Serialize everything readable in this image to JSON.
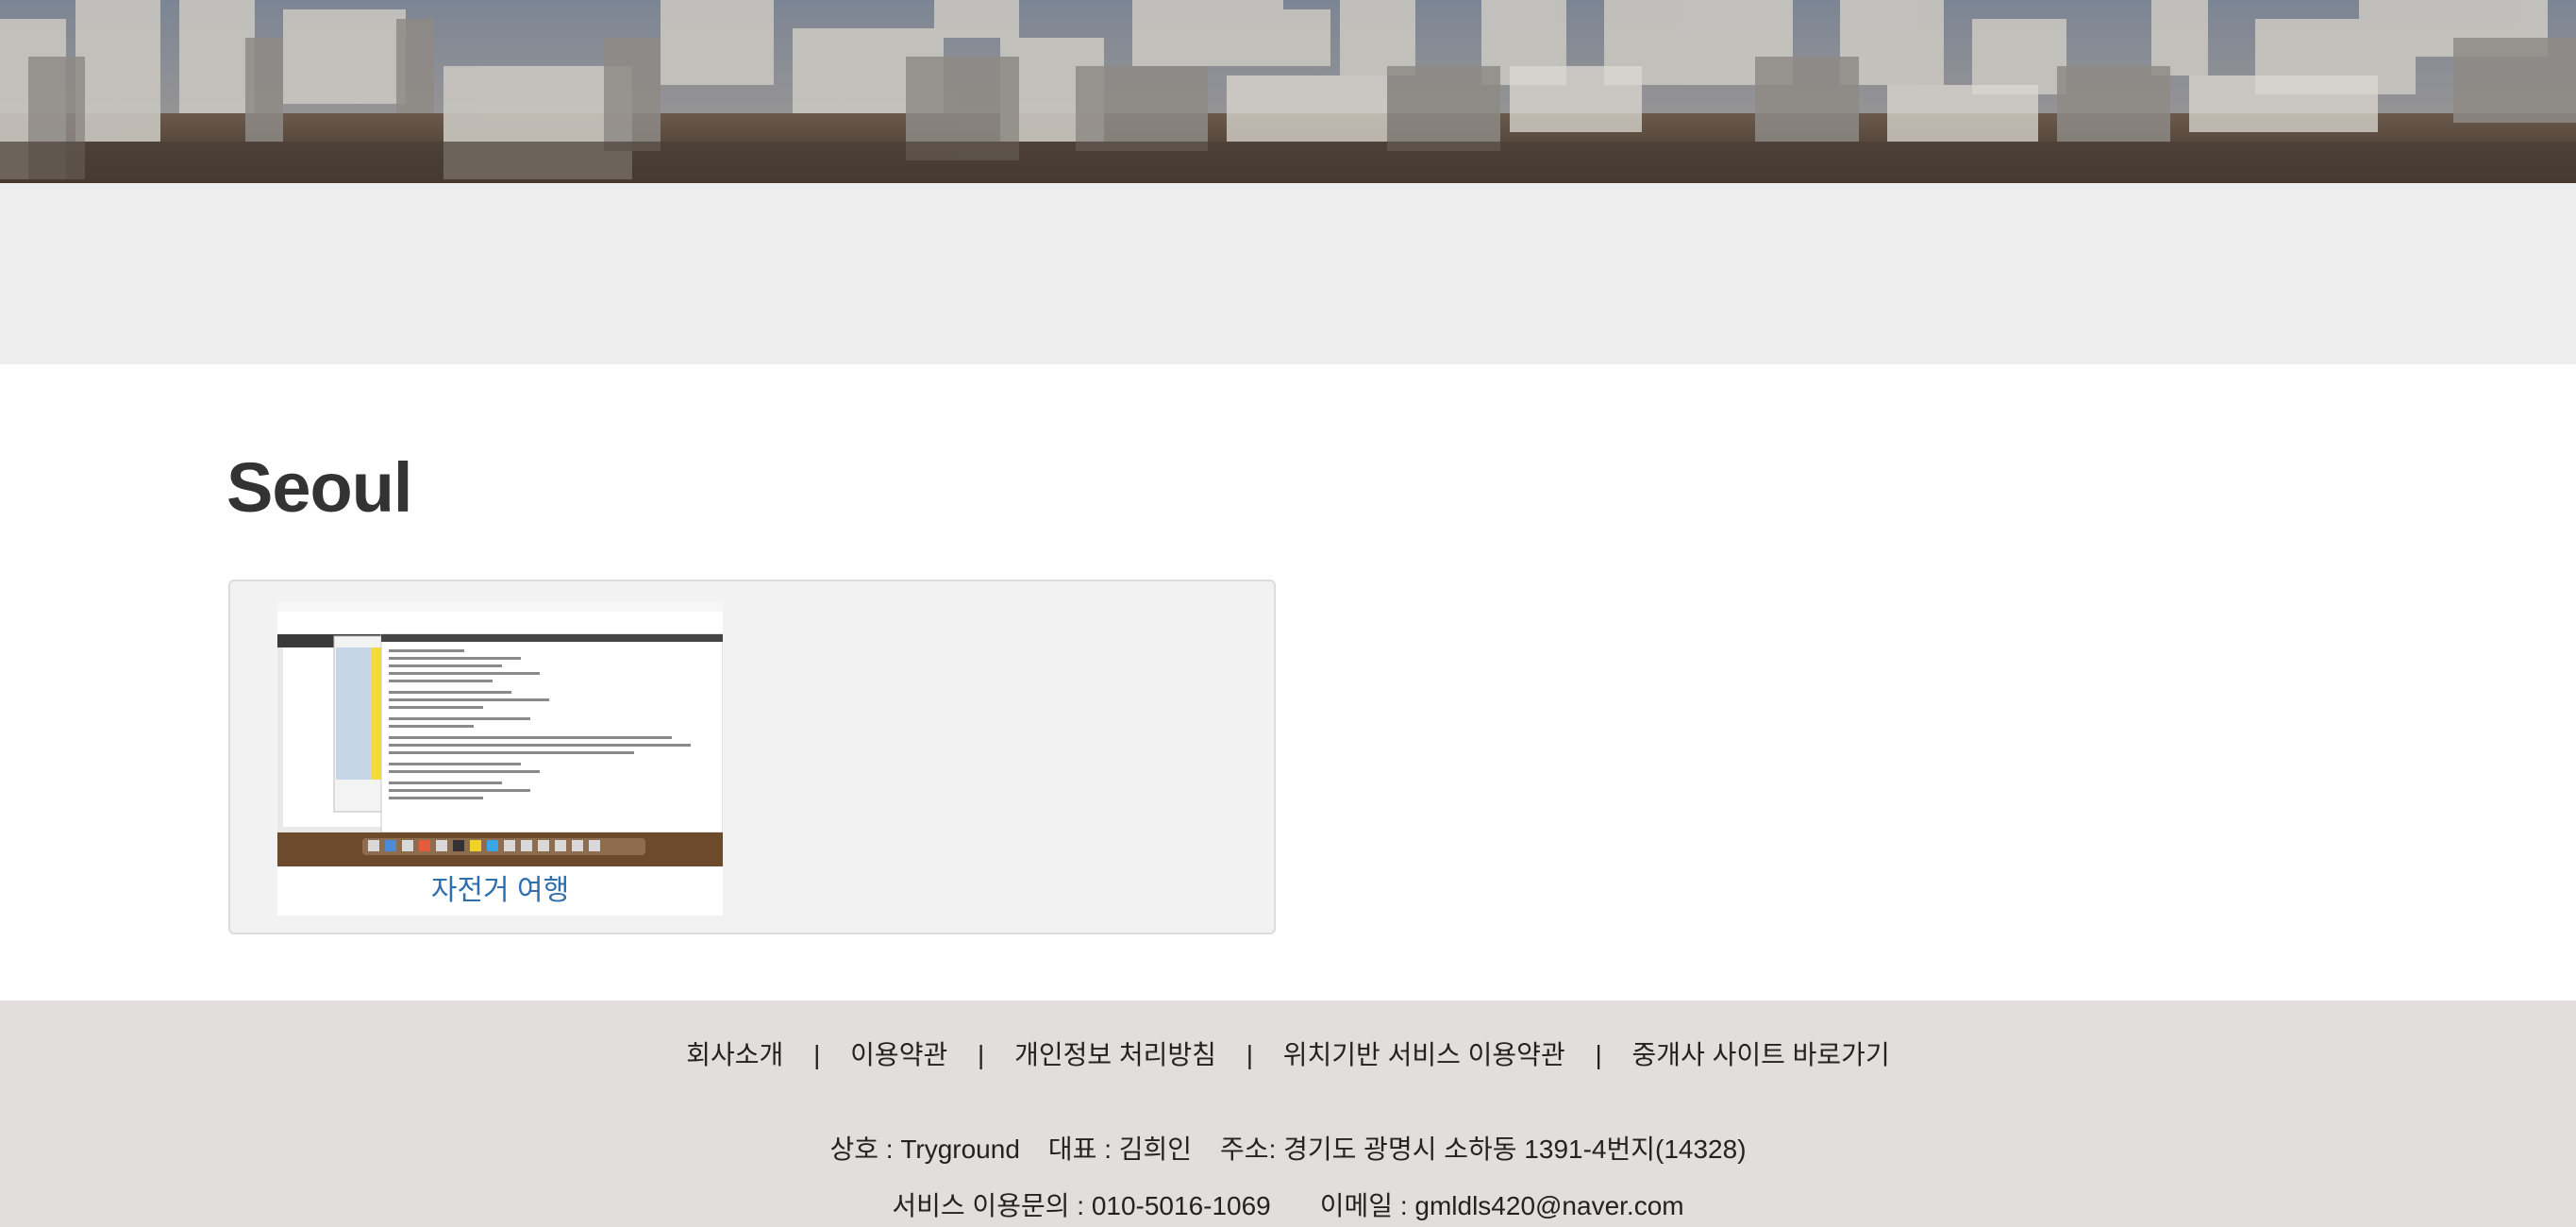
{
  "page": {
    "title": "Seoul"
  },
  "gallery": {
    "items": [
      {
        "caption": "자전거 여행"
      }
    ]
  },
  "footer": {
    "nav": [
      "회사소개",
      "이용약관",
      "개인정보 처리방침",
      "위치기반 서비스 이용약관",
      "중개사 사이트 바로가기"
    ],
    "separator": "|",
    "company_name": "상호 : Tryground",
    "ceo": "대표 : 김희인",
    "address": "주소: 경기도 광명시 소하동 1391-4번지(14328)",
    "phone": "서비스 이용문의 : 010-5016-1069",
    "email": "이메일 : gmldls420@naver.com"
  },
  "colors": {
    "gray_band": "#ededed",
    "footer_bg": "#e3dede",
    "caption_link": "#2f6fae",
    "title_text": "#333333"
  }
}
